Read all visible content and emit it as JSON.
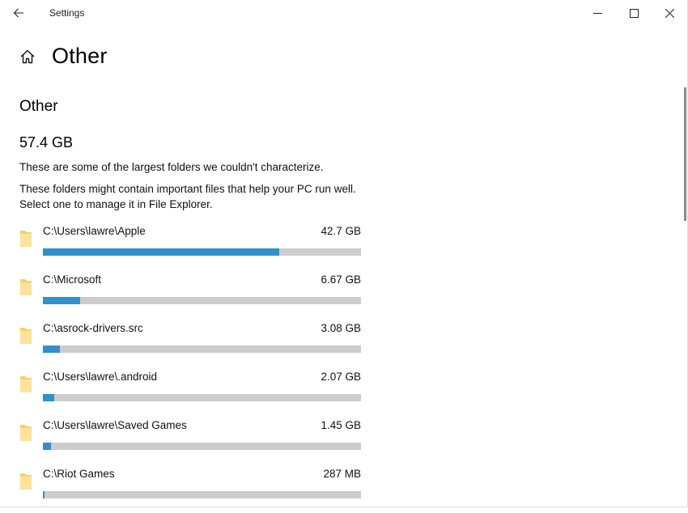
{
  "window": {
    "title": "Settings",
    "controls": {
      "back": "back-arrow-icon",
      "minimize": "minimize-icon",
      "maximize": "maximize-icon",
      "close": "close-icon"
    }
  },
  "header": {
    "home_icon": "home-icon",
    "title": "Other"
  },
  "section": {
    "title": "Other",
    "total_size": "57.4 GB",
    "description": "These are some of the largest folders we couldn't characterize.",
    "hint": "These folders might contain important files that help your PC run well. Select one to manage it in File Explorer."
  },
  "colors": {
    "bar_fill": "#2f8fcf",
    "bar_track": "#cccccc",
    "folder_icon": "#f5d06a"
  },
  "folders": [
    {
      "path": "C:\\Users\\lawre\\Apple",
      "size": "42.7 GB",
      "usage_fraction": 0.743
    },
    {
      "path": "C:\\Microsoft",
      "size": "6.67 GB",
      "usage_fraction": 0.116
    },
    {
      "path": "C:\\asrock-drivers.src",
      "size": "3.08 GB",
      "usage_fraction": 0.054
    },
    {
      "path": "C:\\Users\\lawre\\.android",
      "size": "2.07 GB",
      "usage_fraction": 0.036
    },
    {
      "path": "C:\\Users\\lawre\\Saved Games",
      "size": "1.45 GB",
      "usage_fraction": 0.025
    },
    {
      "path": "C:\\Riot Games",
      "size": "287 MB",
      "usage_fraction": 0.005
    }
  ]
}
